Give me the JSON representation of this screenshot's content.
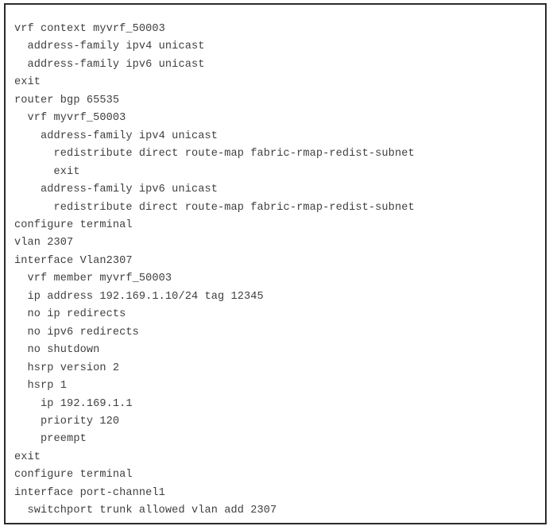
{
  "window": {
    "type": "code-snippet-figure",
    "frame_border_color": "#2b2b2b",
    "background_color": "#ffffff",
    "text_color": "#3f3f3f"
  },
  "code": {
    "language": "cisco-nxos-cli",
    "line_count": 26,
    "lines": [
      "vrf context myvrf_50003",
      "  address-family ipv4 unicast",
      "  address-family ipv6 unicast",
      "exit",
      "router bgp 65535",
      "  vrf myvrf_50003",
      "    address-family ipv4 unicast",
      "      redistribute direct route-map fabric-rmap-redist-subnet",
      "      exit",
      "    address-family ipv6 unicast",
      "      redistribute direct route-map fabric-rmap-redist-subnet",
      "configure terminal",
      "vlan 2307",
      "interface Vlan2307",
      "  vrf member myvrf_50003",
      "  ip address 192.169.1.10/24 tag 12345",
      "  no ip redirects",
      "  no ipv6 redirects",
      "  no shutdown",
      "  hsrp version 2",
      "  hsrp 1",
      "    ip 192.169.1.1",
      "    priority 120",
      "    preempt",
      "exit",
      "configure terminal",
      "interface port-channel1",
      "  switchport trunk allowed vlan add 2307"
    ]
  }
}
